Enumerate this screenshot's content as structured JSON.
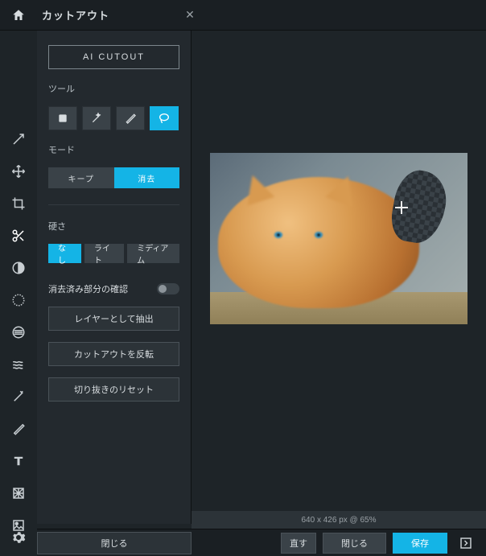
{
  "header": {
    "panel_title": "カットアウト"
  },
  "panel": {
    "ai_cutout": "AI CUTOUT",
    "tools_label": "ツール",
    "mode_label": "モード",
    "mode_keep": "キープ",
    "mode_erase": "消去",
    "hardness_label": "硬さ",
    "hardness_none": "なし",
    "hardness_light": "ライト",
    "hardness_medium": "ミディアム",
    "confirm_erased_label": "消去済み部分の確認",
    "extract_layer": "レイヤーとして抽出",
    "invert_cutout": "カットアウトを反転",
    "reset_crop": "切り抜きのリセット",
    "close": "閉じる"
  },
  "status": {
    "dimensions": "640 x 426 px @ 65%"
  },
  "footer": {
    "redo": "直す",
    "close": "閉じる",
    "save": "保存"
  },
  "colors": {
    "accent": "#14b4e6"
  }
}
